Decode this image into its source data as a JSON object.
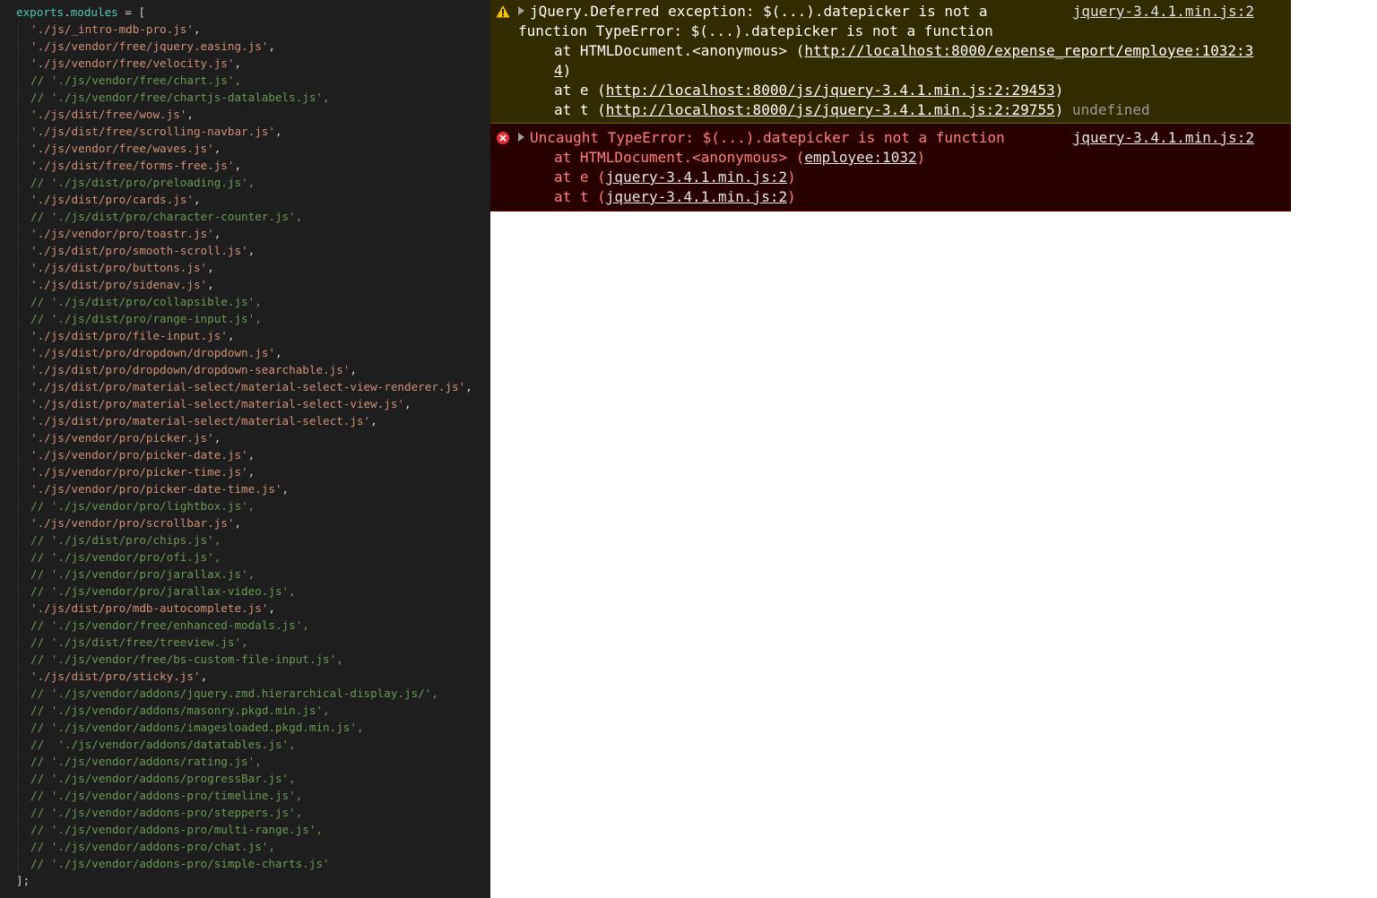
{
  "editor": {
    "first_line": {
      "ident": "exports",
      "dot": ".",
      "prop": "modules",
      "rest": " = ["
    },
    "lines": [
      {
        "text": "'./js/_intro-mdb-pro.js'",
        "suffix": ",",
        "comment": false
      },
      {
        "text": "'./js/vendor/free/jquery.easing.js'",
        "suffix": ",",
        "comment": false
      },
      {
        "text": "'./js/vendor/free/velocity.js'",
        "suffix": ",",
        "comment": false
      },
      {
        "text": "// './js/vendor/free/chart.js',",
        "suffix": "",
        "comment": true
      },
      {
        "text": "// './js/vendor/free/chartjs-datalabels.js',",
        "suffix": "",
        "comment": true
      },
      {
        "text": "'./js/dist/free/wow.js'",
        "suffix": ",",
        "comment": false
      },
      {
        "text": "'./js/dist/free/scrolling-navbar.js'",
        "suffix": ",",
        "comment": false
      },
      {
        "text": "'./js/vendor/free/waves.js'",
        "suffix": ",",
        "comment": false
      },
      {
        "text": "'./js/dist/free/forms-free.js'",
        "suffix": ",",
        "comment": false
      },
      {
        "text": "// './js/dist/pro/preloading.js',",
        "suffix": "",
        "comment": true
      },
      {
        "text": "'./js/dist/pro/cards.js'",
        "suffix": ",",
        "comment": false
      },
      {
        "text": "// './js/dist/pro/character-counter.js',",
        "suffix": "",
        "comment": true
      },
      {
        "text": "'./js/vendor/pro/toastr.js'",
        "suffix": ",",
        "comment": false
      },
      {
        "text": "'./js/dist/pro/smooth-scroll.js'",
        "suffix": ",",
        "comment": false
      },
      {
        "text": "'./js/dist/pro/buttons.js'",
        "suffix": ",",
        "comment": false
      },
      {
        "text": "'./js/dist/pro/sidenav.js'",
        "suffix": ",",
        "comment": false
      },
      {
        "text": "// './js/dist/pro/collapsible.js',",
        "suffix": "",
        "comment": true
      },
      {
        "text": "// './js/dist/pro/range-input.js',",
        "suffix": "",
        "comment": true
      },
      {
        "text": "'./js/dist/pro/file-input.js'",
        "suffix": ",",
        "comment": false
      },
      {
        "text": "'./js/dist/pro/dropdown/dropdown.js'",
        "suffix": ",",
        "comment": false
      },
      {
        "text": "'./js/dist/pro/dropdown/dropdown-searchable.js'",
        "suffix": ",",
        "comment": false
      },
      {
        "text": "'./js/dist/pro/material-select/material-select-view-renderer.js'",
        "suffix": ",",
        "comment": false
      },
      {
        "text": "'./js/dist/pro/material-select/material-select-view.js'",
        "suffix": ",",
        "comment": false
      },
      {
        "text": "'./js/dist/pro/material-select/material-select.js'",
        "suffix": ",",
        "comment": false
      },
      {
        "text": "'./js/vendor/pro/picker.js'",
        "suffix": ",",
        "comment": false
      },
      {
        "text": "'./js/vendor/pro/picker-date.js'",
        "suffix": ",",
        "comment": false
      },
      {
        "text": "'./js/vendor/pro/picker-time.js'",
        "suffix": ",",
        "comment": false
      },
      {
        "text": "'./js/vendor/pro/picker-date-time.js'",
        "suffix": ",",
        "comment": false
      },
      {
        "text": "// './js/vendor/pro/lightbox.js',",
        "suffix": "",
        "comment": true
      },
      {
        "text": "'./js/vendor/pro/scrollbar.js'",
        "suffix": ",",
        "comment": false
      },
      {
        "text": "// './js/dist/pro/chips.js',",
        "suffix": "",
        "comment": true
      },
      {
        "text": "// './js/vendor/pro/ofi.js',",
        "suffix": "",
        "comment": true
      },
      {
        "text": "// './js/vendor/pro/jarallax.js',",
        "suffix": "",
        "comment": true
      },
      {
        "text": "// './js/vendor/pro/jarallax-video.js',",
        "suffix": "",
        "comment": true
      },
      {
        "text": "'./js/dist/pro/mdb-autocomplete.js'",
        "suffix": ",",
        "comment": false
      },
      {
        "text": "// './js/vendor/free/enhanced-modals.js',",
        "suffix": "",
        "comment": true
      },
      {
        "text": "// './js/dist/free/treeview.js',",
        "suffix": "",
        "comment": true
      },
      {
        "text": "// './js/vendor/free/bs-custom-file-input.js',",
        "suffix": "",
        "comment": true
      },
      {
        "text": "'./js/dist/pro/sticky.js'",
        "suffix": ",",
        "comment": false
      },
      {
        "text": "// './js/vendor/addons/jquery.zmd.hierarchical-display.js/',",
        "suffix": "",
        "comment": true
      },
      {
        "text": "// './js/vendor/addons/masonry.pkgd.min.js',",
        "suffix": "",
        "comment": true
      },
      {
        "text": "// './js/vendor/addons/imagesloaded.pkgd.min.js',",
        "suffix": "",
        "comment": true
      },
      {
        "text": "//  './js/vendor/addons/datatables.js',",
        "suffix": "",
        "comment": true
      },
      {
        "text": "// './js/vendor/addons/rating.js',",
        "suffix": "",
        "comment": true
      },
      {
        "text": "// './js/vendor/addons/progressBar.js',",
        "suffix": "",
        "comment": true
      },
      {
        "text": "// './js/vendor/addons-pro/timeline.js',",
        "suffix": "",
        "comment": true
      },
      {
        "text": "// './js/vendor/addons-pro/steppers.js',",
        "suffix": "",
        "comment": true
      },
      {
        "text": "// './js/vendor/addons-pro/multi-range.js',",
        "suffix": "",
        "comment": true
      },
      {
        "text": "// './js/vendor/addons-pro/chat.js',",
        "suffix": "",
        "comment": true
      },
      {
        "text": "// './js/vendor/addons-pro/simple-charts.js'",
        "suffix": "",
        "comment": true
      }
    ],
    "last_line": "];"
  },
  "console": {
    "warning": {
      "icon": "warning-icon",
      "first_line": "jQuery.Deferred exception: $(...).datepicker is not a",
      "second_line": "function TypeError: $(...).datepicker is not a function",
      "source": "jquery-3.4.1.min.js:2",
      "stack0_prefix": "at HTMLDocument.<anonymous> (",
      "stack0_url": "http://localhost:8000/expense_report/employee:1032:34",
      "stack0_suffix": ")",
      "stack1_prefix": "at e (",
      "stack1_url": "http://localhost:8000/js/jquery-3.4.1.min.js:2:29453",
      "stack1_suffix": ")",
      "stack2_prefix": "at t (",
      "stack2_url": "http://localhost:8000/js/jquery-3.4.1.min.js:2:29755",
      "stack2_suffix": ")",
      "trailing": "undefined"
    },
    "error": {
      "icon": "error-icon",
      "message": "Uncaught TypeError: $(...).datepicker is not a function",
      "source": "jquery-3.4.1.min.js:2",
      "stack0_prefix": "at HTMLDocument.<anonymous> (",
      "stack0_link": "employee:1032",
      "stack0_suffix": ")",
      "stack1_prefix": "at e (",
      "stack1_link": "jquery-3.4.1.min.js:2",
      "stack1_suffix": ")",
      "stack2_prefix": "at t (",
      "stack2_link": "jquery-3.4.1.min.js:2",
      "stack2_suffix": ")"
    }
  },
  "colors": {
    "editor_bg": "#1e1e1e",
    "string": "#ce9178",
    "comment": "#6a9955",
    "identifier": "#4ec9b0",
    "warning_bg": "#332b00",
    "error_bg": "#290000",
    "error_text": "#ff8080"
  }
}
